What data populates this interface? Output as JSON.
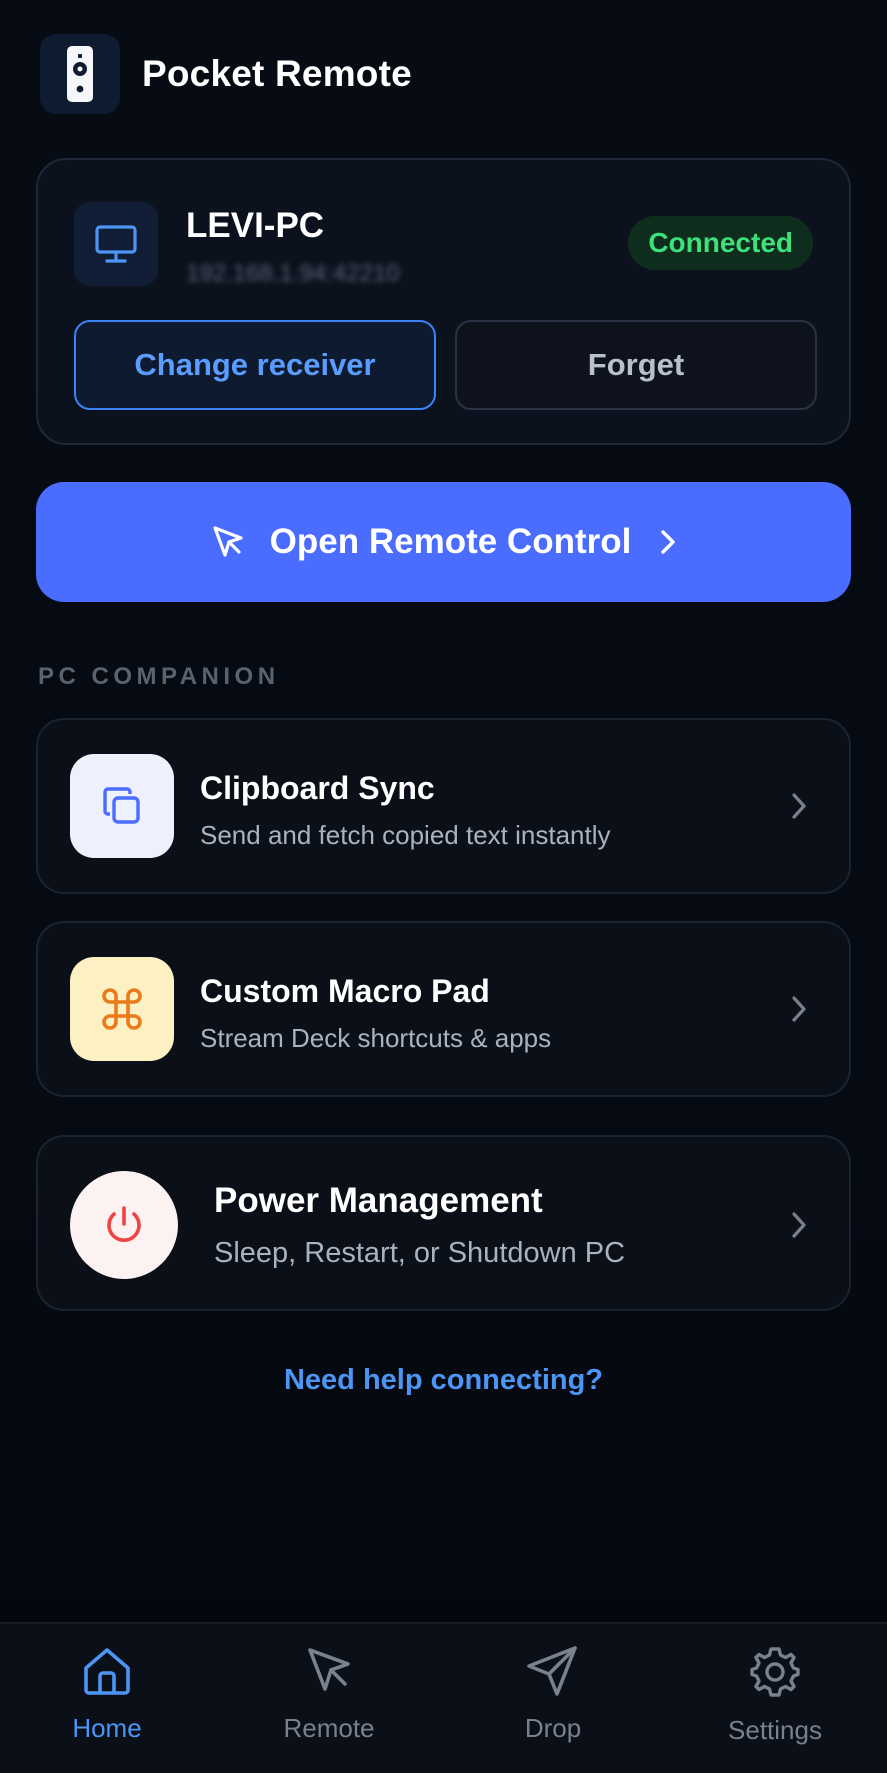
{
  "app": {
    "title": "Pocket Remote",
    "icon": "remote-control-icon"
  },
  "receiver": {
    "name": "LEVI-PC",
    "address": "192.168.1.94:42210",
    "status": "Connected",
    "change_label": "Change receiver",
    "forget_label": "Forget"
  },
  "primary_action": {
    "label": "Open Remote Control"
  },
  "section": {
    "label": "PC COMPANION"
  },
  "features": [
    {
      "title": "Clipboard Sync",
      "subtitle": "Send and fetch copied text instantly",
      "icon": "copy-icon"
    },
    {
      "title": "Custom Macro Pad",
      "subtitle": "Stream Deck shortcuts & apps",
      "icon": "command-icon"
    },
    {
      "title": "Power Management",
      "subtitle": "Sleep, Restart, or Shutdown PC",
      "icon": "power-icon"
    }
  ],
  "help": {
    "label": "Need help connecting?"
  },
  "nav": {
    "items": [
      {
        "label": "Home",
        "icon": "home-icon",
        "active": true
      },
      {
        "label": "Remote",
        "icon": "cursor-icon",
        "active": false
      },
      {
        "label": "Drop",
        "icon": "send-icon",
        "active": false
      },
      {
        "label": "Settings",
        "icon": "gear-icon",
        "active": false
      }
    ]
  },
  "colors": {
    "accent": "#4a6cff",
    "link": "#4c95f5",
    "connected": "#3ee07a",
    "background": "#06090f"
  }
}
